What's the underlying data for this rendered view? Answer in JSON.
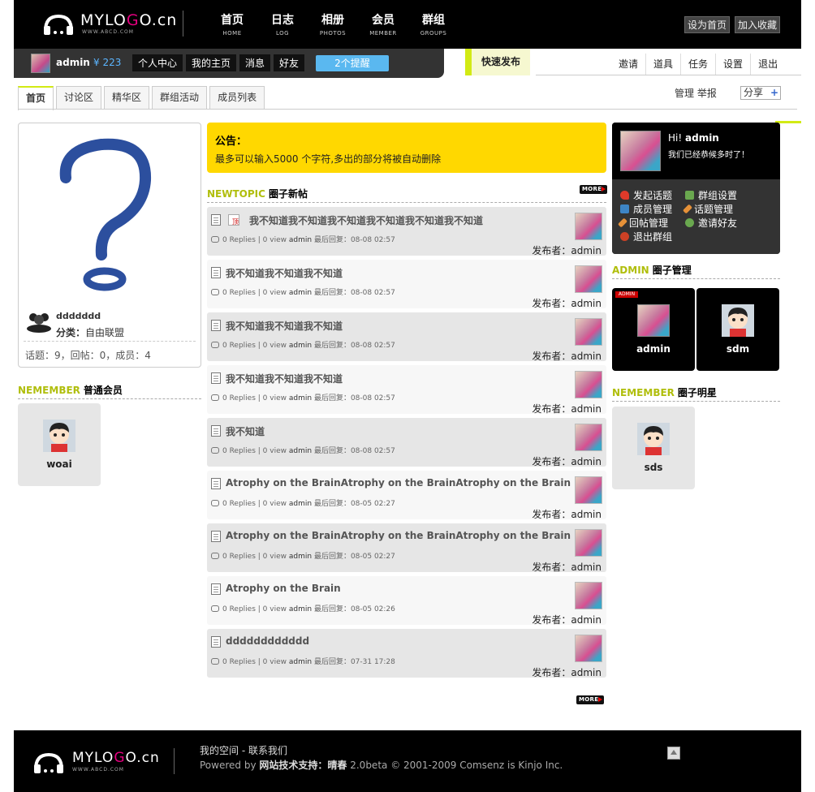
{
  "header": {
    "logo_text_a": "MYLO",
    "logo_text_b": "G",
    "logo_text_c": "O.cn",
    "logo_sub": "WWW.ABCD.COM",
    "nav": [
      {
        "cn": "首页",
        "en": "HOME"
      },
      {
        "cn": "日志",
        "en": "LOG"
      },
      {
        "cn": "相册",
        "en": "PHOTOS"
      },
      {
        "cn": "会员",
        "en": "MEMBER"
      },
      {
        "cn": "群组",
        "en": "GROUPS"
      }
    ],
    "set_home": "设为首页",
    "add_fav": "加入收藏"
  },
  "userbar": {
    "username": "admin",
    "coins": "¥ 223",
    "buttons": [
      "个人中心",
      "我的主页",
      "消息",
      "好友"
    ],
    "remind": "2个提醒",
    "quick_post": "快速发布",
    "right_tabs": [
      "邀请",
      "道具",
      "任务",
      "设置",
      "退出"
    ]
  },
  "subtabs": [
    "首页",
    "讨论区",
    "精华区",
    "群组活动",
    "成员列表"
  ],
  "admin_links": "管理  举报",
  "share": "分享",
  "share_plus": "+",
  "group": {
    "name": "ddddddd",
    "category_label": "分类：",
    "category": "自由联盟",
    "stats": "话题：9，回帖：0，成员：4"
  },
  "members_section": {
    "en": "NEMEMBER",
    "cn": "普通会员"
  },
  "members": [
    {
      "name": "woai"
    }
  ],
  "notice": {
    "title": "公告：",
    "text": "最多可以输入5000 个字符,多出的部分将被自动删除"
  },
  "topics_section": {
    "en": "NEWTOPIC",
    "cn": "圈子新帖"
  },
  "more_label": "MORE",
  "topics": [
    {
      "title": "我不知道我不知道我不知道我不知道我不知道我不知道",
      "replies": "0 Replies | 0 view",
      "user": "admin",
      "last": "最后回复：08-08 02:57",
      "author": "发布者：admin",
      "sticky": true,
      "sticky_label": "顶"
    },
    {
      "title": "我不知道我不知道我不知道",
      "replies": "0 Replies | 0 view",
      "user": "admin",
      "last": "最后回复：08-08 02:57",
      "author": "发布者：admin",
      "sticky": false
    },
    {
      "title": "我不知道我不知道我不知道",
      "replies": "0 Replies | 0 view",
      "user": "admin",
      "last": "最后回复：08-08 02:57",
      "author": "发布者：admin",
      "sticky": false
    },
    {
      "title": "我不知道我不知道我不知道",
      "replies": "0 Replies | 0 view",
      "user": "admin",
      "last": "最后回复：08-08 02:57",
      "author": "发布者：admin",
      "sticky": false
    },
    {
      "title": "我不知道",
      "replies": "0 Replies | 0 view",
      "user": "admin",
      "last": "最后回复：08-08 02:57",
      "author": "发布者：admin",
      "sticky": false
    },
    {
      "title": "Atrophy on the BrainAtrophy on the BrainAtrophy on the Brain",
      "replies": "0 Replies | 0 view",
      "user": "admin",
      "last": "最后回复：08-05 02:27",
      "author": "发布者：admin",
      "sticky": false
    },
    {
      "title": "Atrophy on the BrainAtrophy on the BrainAtrophy on the Brain",
      "replies": "0 Replies | 0 view",
      "user": "admin",
      "last": "最后回复：08-05 02:27",
      "author": "发布者：admin",
      "sticky": false
    },
    {
      "title": "Atrophy on the Brain",
      "replies": "0 Replies | 0 view",
      "user": "admin",
      "last": "最后回复：08-05 02:26",
      "author": "发布者：admin",
      "sticky": false
    },
    {
      "title": "dddddddddddd",
      "replies": "0 Replies | 0 view",
      "user": "admin",
      "last": "最后回复：07-31 17:28",
      "author": "发布者：admin",
      "sticky": false
    }
  ],
  "profile": {
    "hi": "Hi!",
    "name": "admin",
    "message": "我们已经恭候多时了！",
    "actions": [
      {
        "label": "发起话题",
        "icon": "heart-icon",
        "color": "#e03a2a"
      },
      {
        "label": "群组设置",
        "icon": "settings-icon",
        "color": "#6aa84f"
      },
      {
        "label": "成员管理",
        "icon": "members-icon",
        "color": "#3d85c6"
      },
      {
        "label": "话题管理",
        "icon": "pencil-icon",
        "color": "#e69138"
      },
      {
        "label": "回帖管理",
        "icon": "pencil-icon",
        "color": "#e69138"
      },
      {
        "label": "邀请好友",
        "icon": "user-add-icon",
        "color": "#6aa84f"
      },
      {
        "label": "退出群组",
        "icon": "exit-icon",
        "color": "#cc4125"
      }
    ]
  },
  "admin_section": {
    "en": "ADMIN",
    "cn": "圈子管理"
  },
  "admins": [
    {
      "name": "admin",
      "badge": "ADMIN"
    },
    {
      "name": "sdm"
    }
  ],
  "stars_section": {
    "en": "NEMEMBER",
    "cn": "圈子明星"
  },
  "stars": [
    {
      "name": "sds"
    }
  ],
  "footer": {
    "links": "我的空间  - 联系我们",
    "powered": "Powered by",
    "support": "网站技术支持：晴春",
    "copy": "2.0beta © 2001-2009 Comsenz is Kinjo Inc."
  }
}
